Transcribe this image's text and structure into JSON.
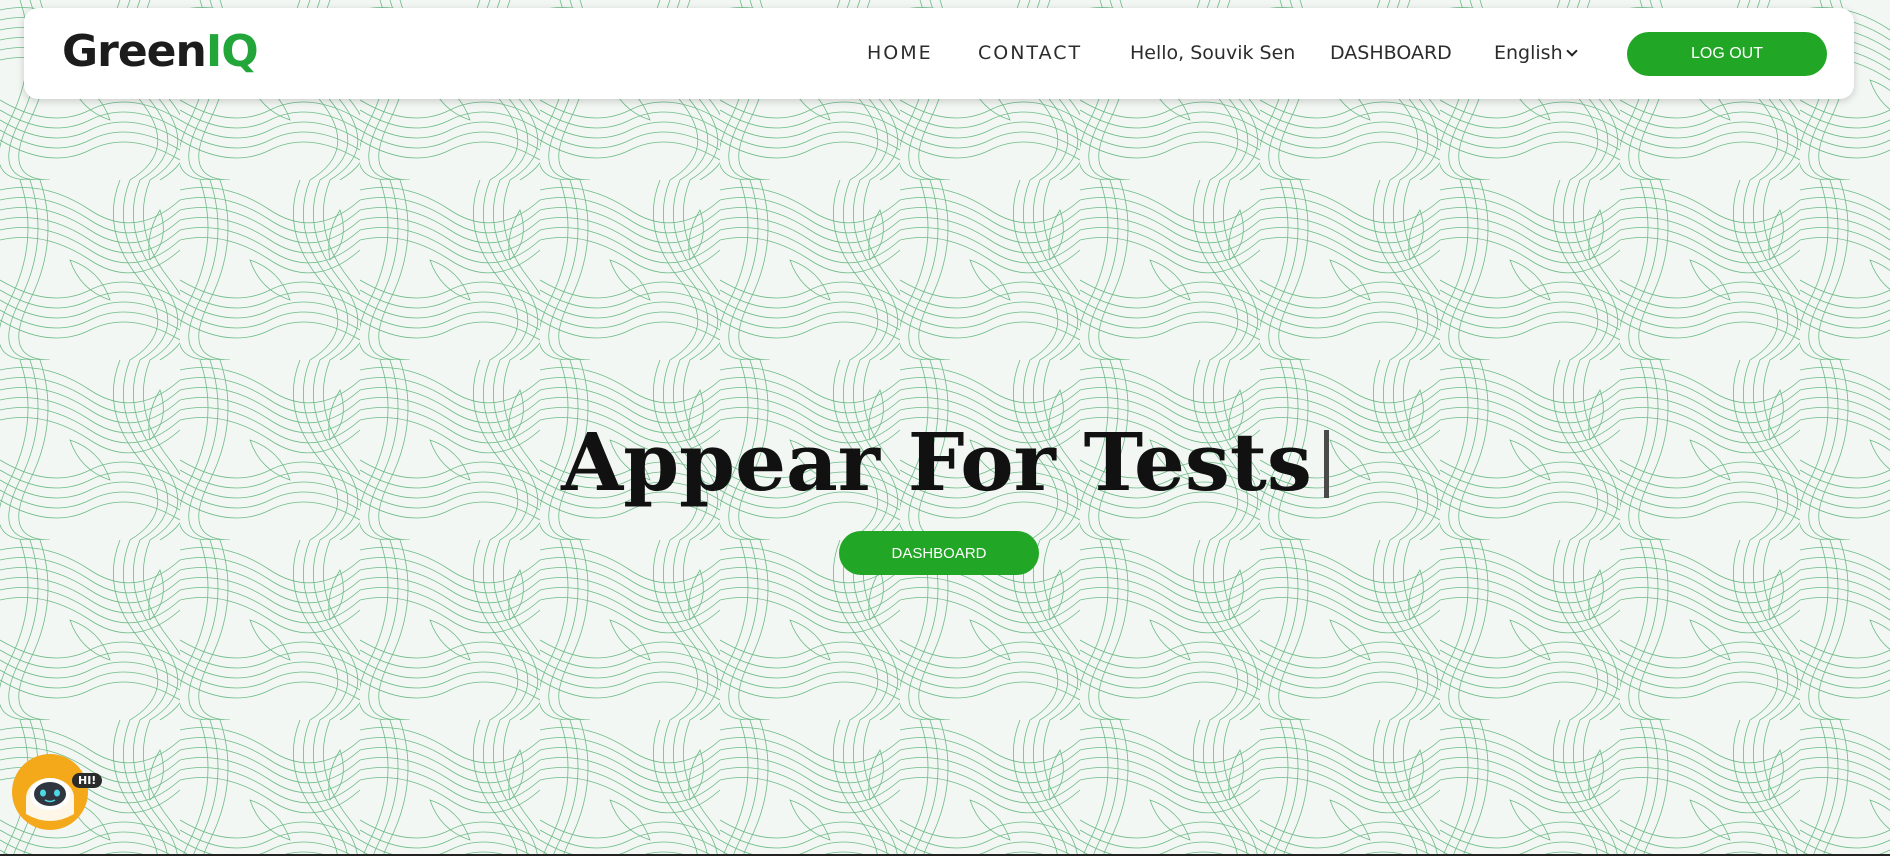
{
  "brand": {
    "logo_text_main": "Green",
    "logo_text_accent": "IQ"
  },
  "nav": {
    "home_label": "HOME",
    "contact_label": "CONTACT",
    "greeting": "Hello, Souvik Sen",
    "dashboard_label": "DASHBOARD",
    "language": "English",
    "logout_label": "LOG OUT"
  },
  "hero": {
    "title": "Appear For Tests",
    "button_label": "DASHBOARD"
  },
  "chatbot": {
    "badge": "HI!"
  },
  "colors": {
    "accent": "#22a625",
    "pattern_stroke": "#3ea563",
    "background": "#f3f7f3",
    "chatbot": "#f4a91b"
  },
  "icons": [
    "chevron-down-icon",
    "chatbot-robot-icon"
  ]
}
